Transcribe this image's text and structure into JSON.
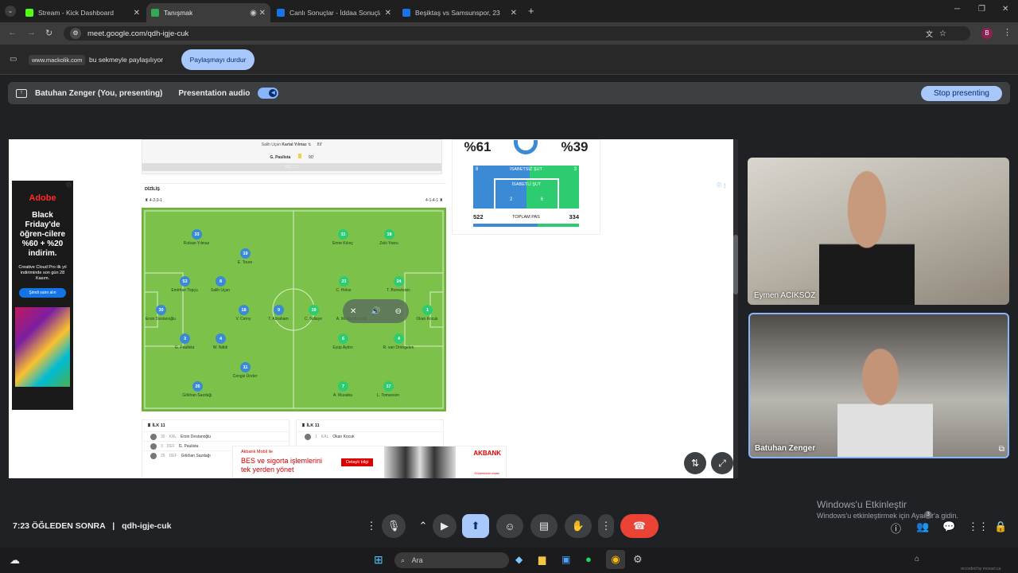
{
  "browser": {
    "tabs": [
      {
        "label": "Stream - Kick Dashboard",
        "icon": "kick-icon"
      },
      {
        "label": "Tanışmak",
        "icon": "meet-icon",
        "active": true
      },
      {
        "label": "Canlı Sonuçlar - İddaa Sonuçla",
        "icon": "mackolik-icon"
      },
      {
        "label": "Beşiktaş vs Samsunspor, 23",
        "icon": "mackolik-icon"
      }
    ],
    "url": "meet.google.com/qdh-igje-cuk",
    "profile_initial": "B"
  },
  "sharebar": {
    "domain": "www.mackolik.com",
    "text": "bu sekmeyle paylaşılıyor",
    "stop_label": "Paylaşmayı durdur"
  },
  "meet": {
    "presenter": "Batuhan Zenger (You, presenting)",
    "audio_label": "Presentation audio",
    "stop_presenting": "Stop presenting",
    "time": "7:23 ÖĞLEDEN SONRA",
    "separator": "|",
    "code": "qdh-igje-cuk",
    "participants": [
      {
        "name": "Eymen ACIKSÖZ"
      },
      {
        "name": "Batuhan Zenger"
      }
    ],
    "people_count": "3"
  },
  "page": {
    "events": {
      "row1_left": "Salih Uçan",
      "row1_right": "Kartal Yılmaz",
      "row1_min": "89'",
      "row2_player": "G. Paulista",
      "row2_min": "90'",
      "ms": "MS 1-1"
    },
    "dizilis": {
      "title": "DİZİLİŞ",
      "home_formation": "4-2-3-1",
      "away_formation": "4-1-4-1"
    },
    "stats": {
      "home_pct": "%61",
      "away_pct": "%39",
      "isabetsiz_label": "İSABETSİZ ŞUT",
      "isabetsiz_home": "8",
      "isabetsiz_away": "3",
      "isabetli_label": "İSABETLİ ŞUT",
      "isabetli_home": "2",
      "isabetli_away": "6",
      "pas_label": "TOPLAM PAS",
      "pas_home": "522",
      "pas_away": "334"
    },
    "home_players": [
      {
        "no": "33",
        "name": "Rıdvan Yılmaz"
      },
      {
        "no": "19",
        "name": "E. Toure"
      },
      {
        "no": "53",
        "name": "Emirhan Topçu"
      },
      {
        "no": "8",
        "name": "Salih Uçan"
      },
      {
        "no": "30",
        "name": "Ersin Destanoğlu"
      },
      {
        "no": "18",
        "name": "V. Cerny"
      },
      {
        "no": "9",
        "name": "T. Abraham"
      },
      {
        "no": "3",
        "name": "G. Paulista"
      },
      {
        "no": "4",
        "name": "W. Ndidi"
      },
      {
        "no": "11",
        "name": "Cengiz Ünder"
      },
      {
        "no": "26",
        "name": "Gökhan Sazdağı"
      }
    ],
    "away_players": [
      {
        "no": "11",
        "name": "Emre Kılınç"
      },
      {
        "no": "18",
        "name": "Zeki Yavru"
      },
      {
        "no": "21",
        "name": "C. Holse"
      },
      {
        "no": "24",
        "name": "T. Borevkovic"
      },
      {
        "no": "19",
        "name": "C. Ndiaye"
      },
      {
        "no": "",
        "name": "A. Mouandilmadji"
      },
      {
        "no": "1",
        "name": "Okan Kocuk"
      },
      {
        "no": "6",
        "name": "Eyüp Aydın"
      },
      {
        "no": "4",
        "name": "R. van Drongelen"
      },
      {
        "no": "7",
        "name": "A. Musaba"
      },
      {
        "no": "17",
        "name": "L. Tomasson"
      }
    ],
    "ilk11": {
      "home_title": "İLK 11",
      "away_title": "İLK 11",
      "home_rows": [
        {
          "no": "30",
          "pos": "KAL",
          "name": "Ersin Destanoğlu"
        },
        {
          "no": "3",
          "pos": "DEF",
          "name": "G. Paulista"
        },
        {
          "no": "26",
          "pos": "DEF",
          "name": "Gökhan Sazdağı"
        }
      ],
      "away_rows": [
        {
          "no": "1",
          "pos": "KAL",
          "name": "Okan Kocuk"
        }
      ]
    },
    "ad_left": {
      "brand": "Adobe",
      "headline": "Black Friday'de öğren-cilere %60 + %20 indirim.",
      "body": "Creative Cloud Pro ilk yıl indiriminde son gün 28 Kasım.",
      "cta": "Şimdi satın alın"
    },
    "ad_bottom": {
      "line1": "Akbank Mobil ile",
      "line2": "BES ve sigorta işlemlerini",
      "line3": "tek yerden yönet",
      "cta": "Detaylı bilgi",
      "brand": "AKBANK",
      "slogan": "Güveninizin esası"
    }
  },
  "windows": {
    "activate_title": "Windows'u Etkinleştir",
    "activate_sub": "Windows'u etkinleştirmek için Ayarlar'a gidin.",
    "search_placeholder": "Ara",
    "watermark": "recorded by movavi.ca"
  },
  "colors": {
    "accent_blue": "#a8c7fa",
    "end_call_red": "#ea4335",
    "pitch_green": "#7cc24a",
    "home_blue": "#3a8ad6",
    "away_green": "#2ecc71"
  }
}
